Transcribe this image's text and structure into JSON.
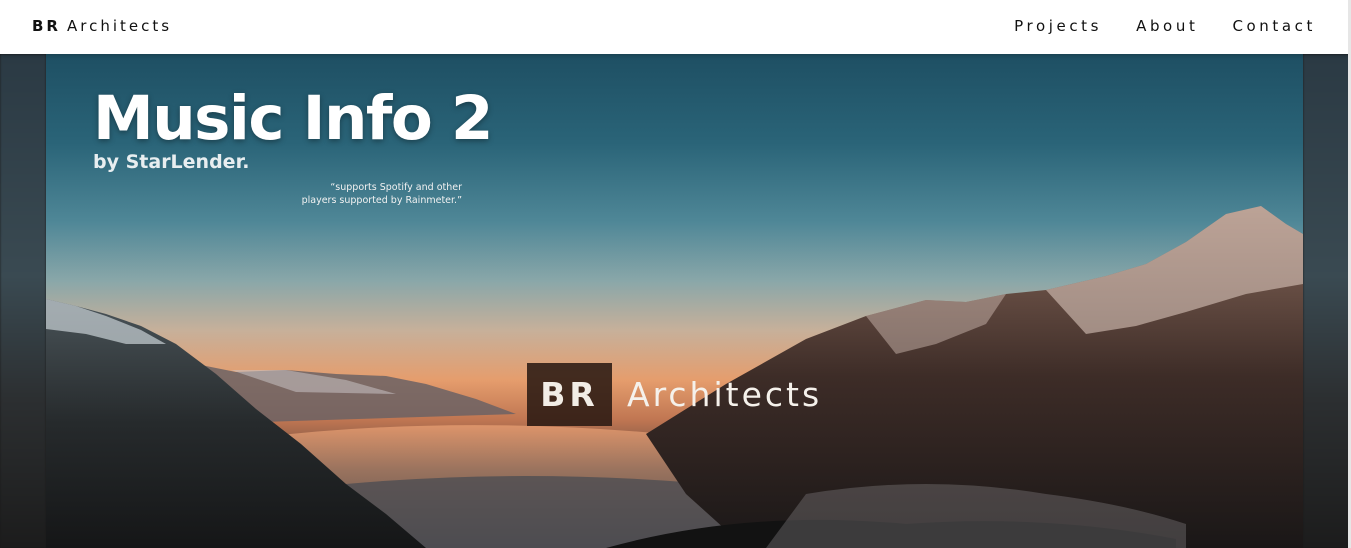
{
  "navbar": {
    "brand_bold": "BR",
    "brand_rest": "Architects",
    "links": [
      {
        "label": "Projects"
      },
      {
        "label": "About"
      },
      {
        "label": "Contact"
      }
    ]
  },
  "hero": {
    "title": "Music Info 2",
    "byline": "by StarLender.",
    "quote_line1": "“supports Spotify and other",
    "quote_line2": "players supported by Rainmeter.”",
    "logo_box": "BR",
    "logo_text": "Architects"
  },
  "colors": {
    "navbar_bg": "#ffffff",
    "sky_top": "#1e4f63",
    "sunset": "#e59d6d",
    "logo_box_bg": "#261610"
  }
}
